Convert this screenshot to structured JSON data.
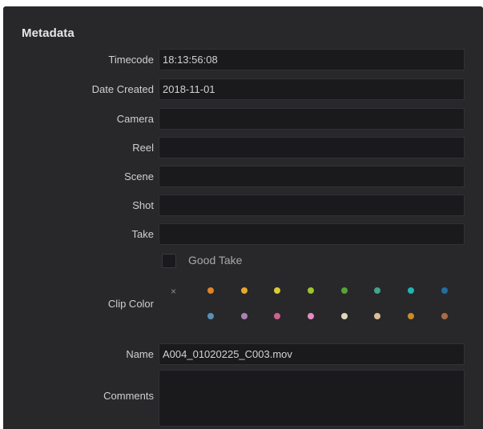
{
  "panel": {
    "title": "Metadata"
  },
  "fields": {
    "timecode": {
      "label": "Timecode",
      "value": "18:13:56:08"
    },
    "date_created": {
      "label": "Date Created",
      "value": "2018-11-01"
    },
    "camera": {
      "label": "Camera",
      "value": ""
    },
    "reel": {
      "label": "Reel",
      "value": ""
    },
    "scene": {
      "label": "Scene",
      "value": ""
    },
    "shot": {
      "label": "Shot",
      "value": ""
    },
    "take": {
      "label": "Take",
      "value": ""
    },
    "name": {
      "label": "Name",
      "value": "A004_01020225_C003.mov"
    },
    "comments": {
      "label": "Comments",
      "value": ""
    }
  },
  "good_take": {
    "label": "Good Take",
    "checked": false
  },
  "clip_color": {
    "label": "Clip Color",
    "none_symbol": "×",
    "colors_row1": [
      "#e0832a",
      "#e8a72e",
      "#d8cc30",
      "#9cc42e",
      "#56a33a",
      "#3fa58b",
      "#20b4b4",
      "#246e9e"
    ],
    "colors_row2": [
      "#5a8fb8",
      "#a784b0",
      "#d0608e",
      "#e48cc4",
      "#e2d6b8",
      "#d9bf98",
      "#c88c26",
      "#a86c48"
    ]
  }
}
